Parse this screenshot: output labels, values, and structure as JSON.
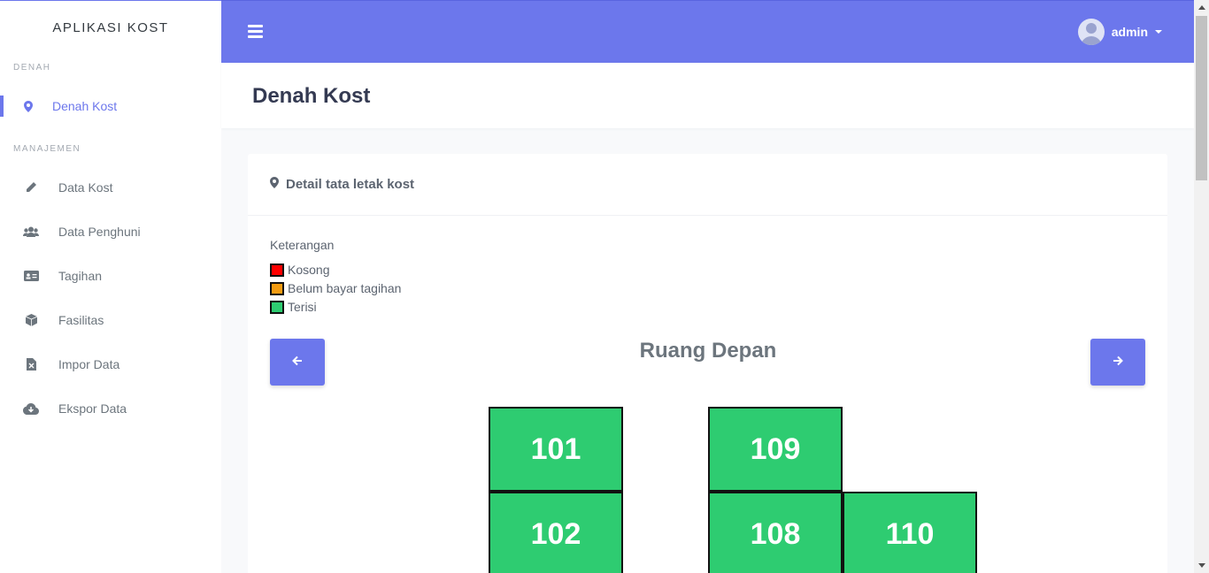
{
  "sidebar": {
    "brand": "APLIKASI KOST",
    "section_denah": "DENAH",
    "section_manajemen": "MANAJEMEN",
    "items": [
      {
        "label": "Denah Kost",
        "icon": "map-marker-icon"
      },
      {
        "label": "Data Kost",
        "icon": "pencil-icon"
      },
      {
        "label": "Data Penghuni",
        "icon": "users-icon"
      },
      {
        "label": "Tagihan",
        "icon": "id-card-icon"
      },
      {
        "label": "Fasilitas",
        "icon": "cube-icon"
      },
      {
        "label": "Impor Data",
        "icon": "file-excel-icon"
      },
      {
        "label": "Ekspor Data",
        "icon": "cloud-download-icon"
      }
    ]
  },
  "topbar": {
    "username": "admin"
  },
  "page": {
    "title": "Denah Kost"
  },
  "card": {
    "title": "Detail tata letak kost",
    "legend_title": "Keterangan",
    "legend": [
      {
        "label": "Kosong",
        "color": "#ff0000"
      },
      {
        "label": "Belum bayar tagihan",
        "color": "#f39c12"
      },
      {
        "label": "Terisi",
        "color": "#2ecc71"
      }
    ],
    "room_area": "Ruang Depan",
    "rooms": [
      {
        "number": "101",
        "status": "Terisi"
      },
      {
        "number": "102",
        "status": "Terisi"
      },
      {
        "number": "109",
        "status": "Terisi"
      },
      {
        "number": "108",
        "status": "Terisi"
      },
      {
        "number": "110",
        "status": "Terisi"
      }
    ]
  },
  "colors": {
    "accent": "#6c77ec",
    "occupied": "#2ecc71"
  }
}
